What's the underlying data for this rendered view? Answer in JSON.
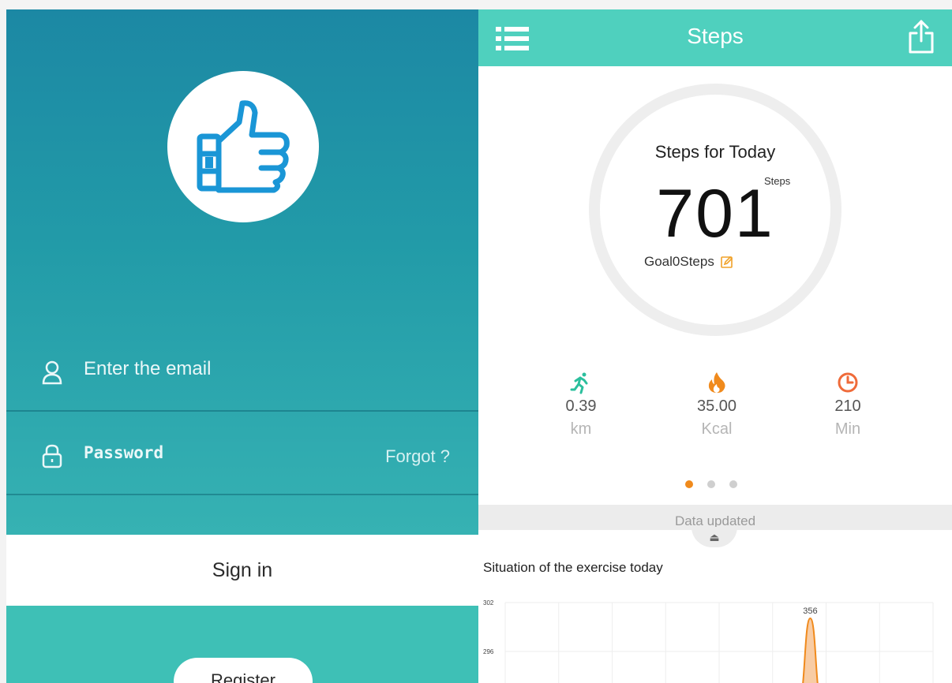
{
  "login": {
    "email_placeholder": "Enter the email",
    "password_placeholder": "Password",
    "forgot_label": "Forgot ?",
    "signin_label": "Sign in",
    "register_label": "Register"
  },
  "steps_screen": {
    "title": "Steps",
    "ring_title": "Steps for Today",
    "step_count": "701",
    "step_unit": "Steps",
    "goal_text": "Goal0Steps",
    "metrics": [
      {
        "value": "0.39",
        "unit": "km",
        "icon": "running-icon",
        "color": "#2bbf9d"
      },
      {
        "value": "35.00",
        "unit": "Kcal",
        "icon": "flame-icon",
        "color": "#f08a1c"
      },
      {
        "value": "210",
        "unit": "Min",
        "icon": "clock-icon",
        "color": "#ef6b3a"
      }
    ],
    "data_updated": "Data updated",
    "section_title": "Situation of the exercise today"
  },
  "colors": {
    "teal_dark": "#1c88a4",
    "teal_light": "#4fd0be",
    "accent_orange": "#f08a1c"
  },
  "chart_data": {
    "type": "area",
    "y_ticks": [
      "302",
      "296"
    ],
    "peak_label": "356",
    "series": [
      {
        "values": [
          0,
          0,
          0,
          0,
          0,
          0,
          356,
          0,
          0
        ]
      }
    ]
  }
}
